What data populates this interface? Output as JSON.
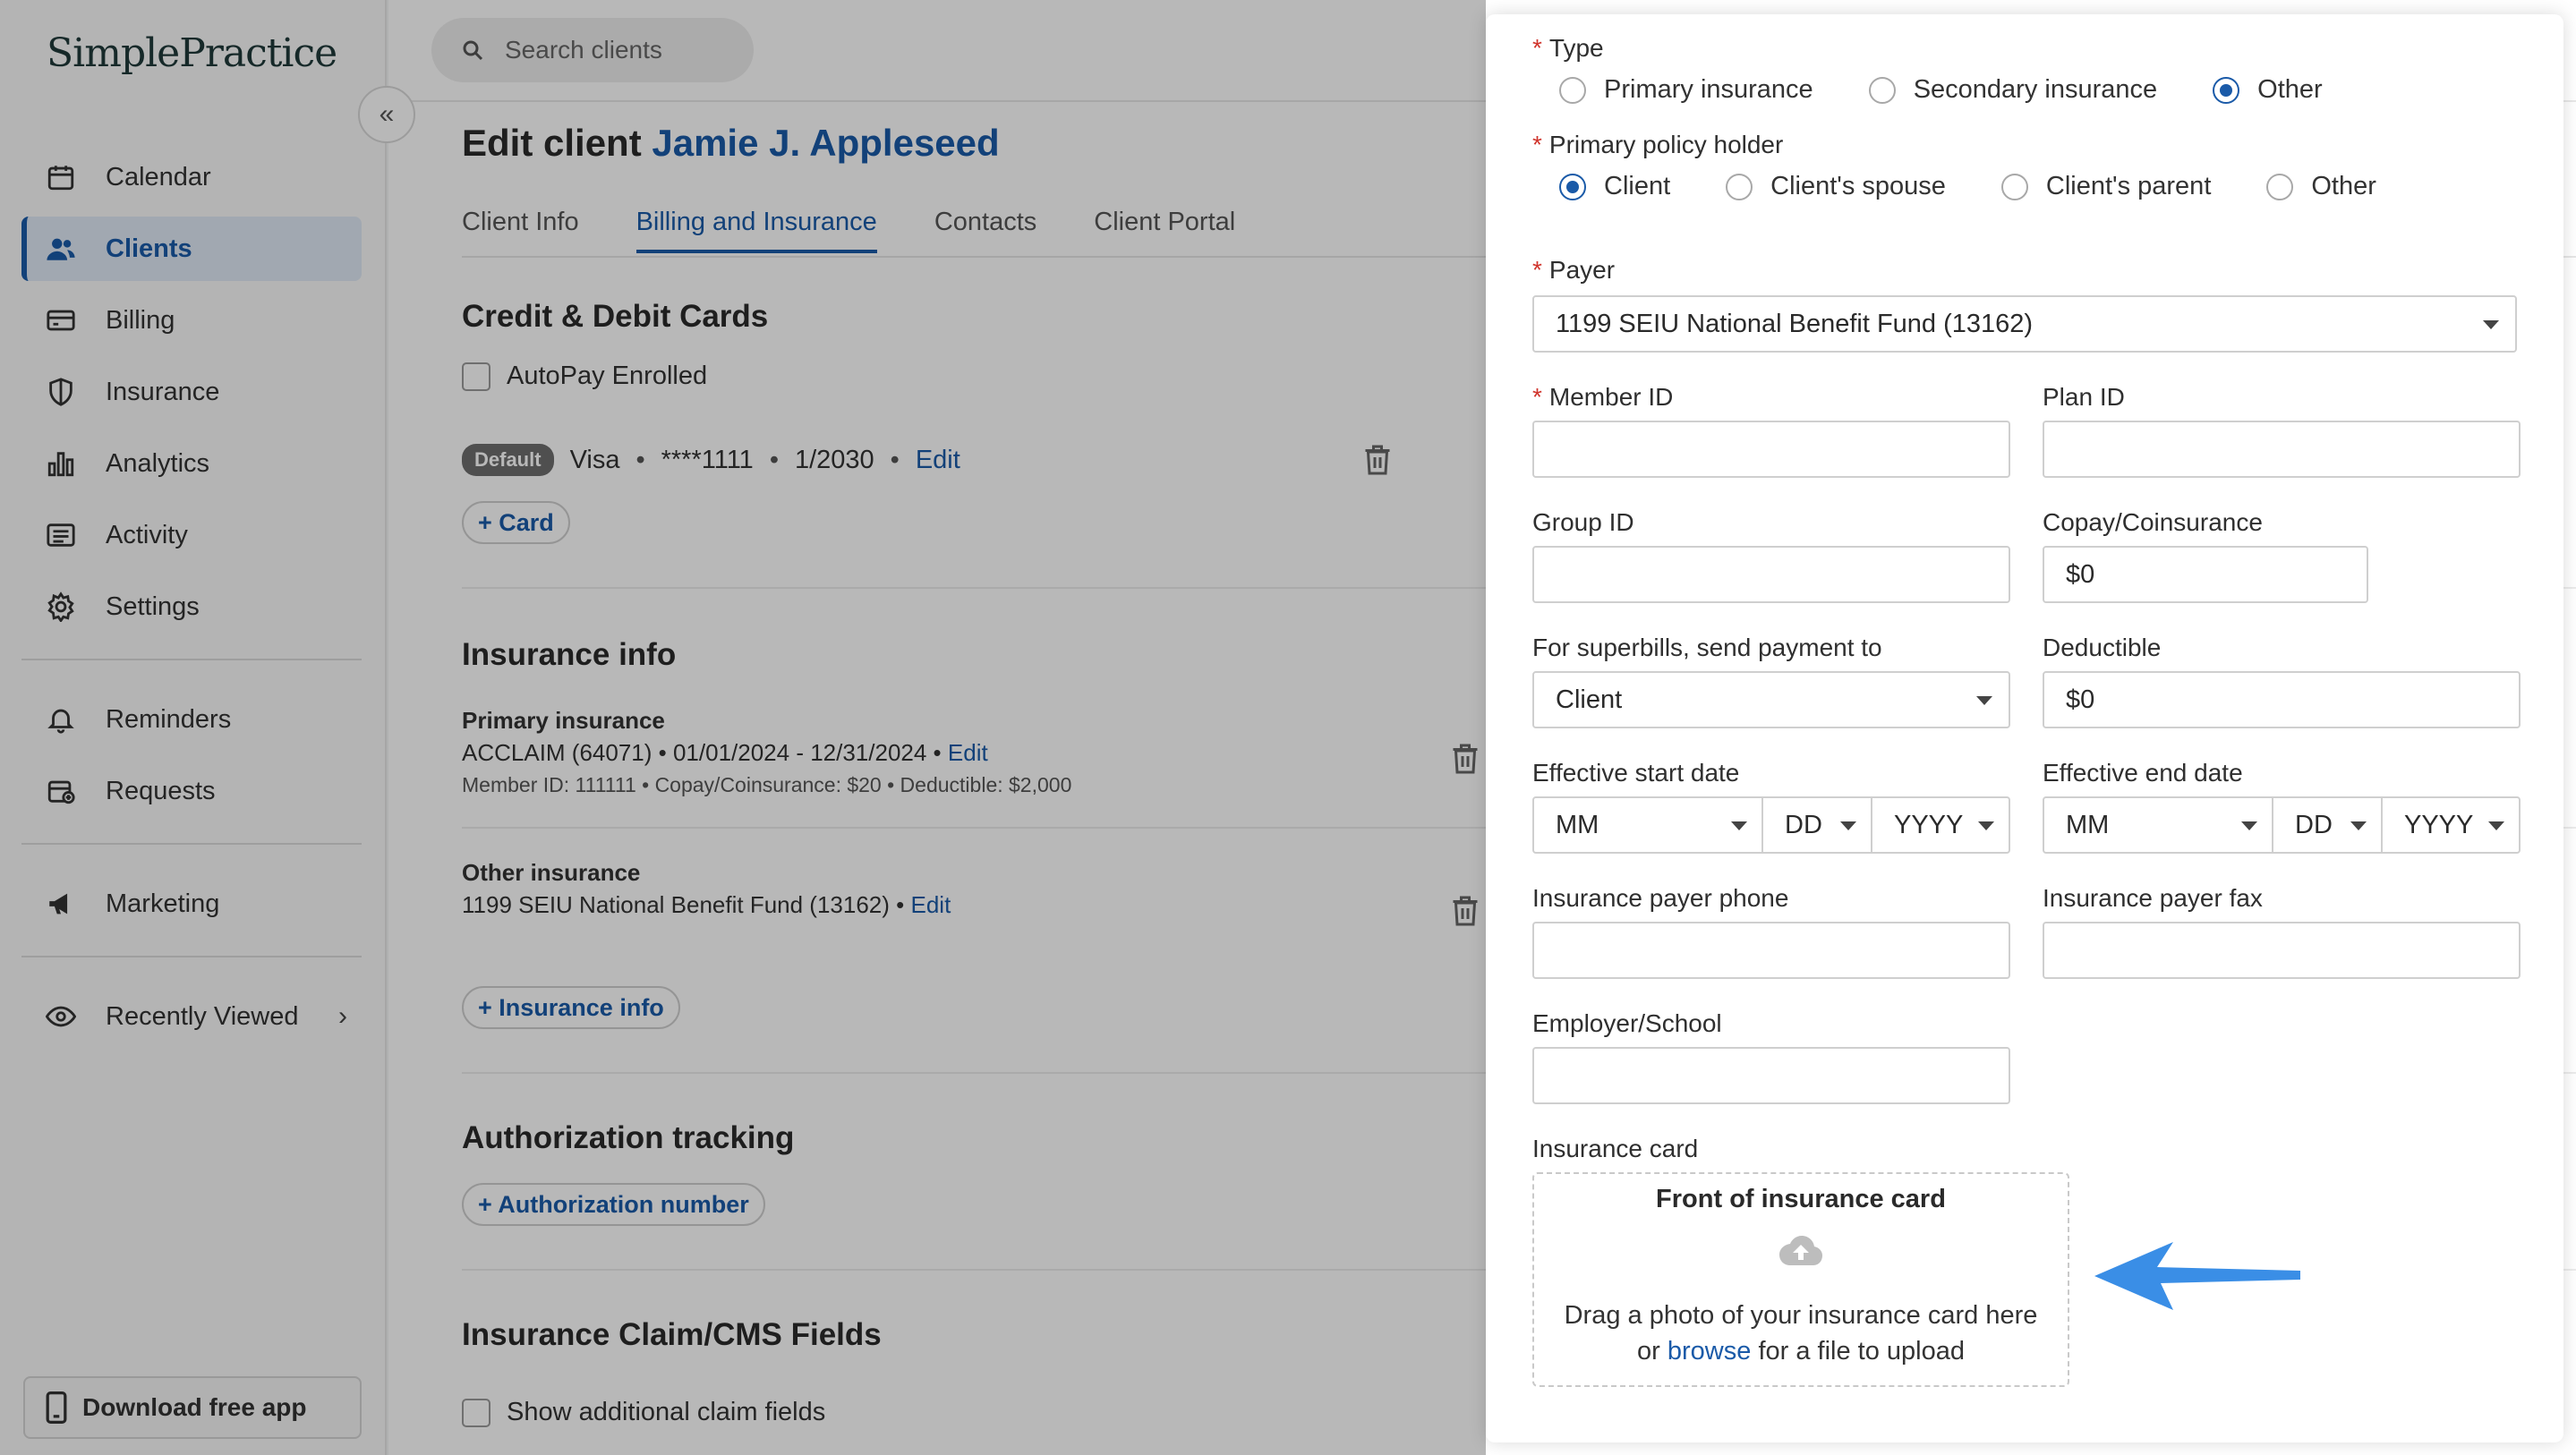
{
  "sidebar": {
    "logo": "SimplePractice",
    "collapse_icon": "«",
    "nav": [
      {
        "label": "Calendar",
        "icon": "calendar-icon"
      },
      {
        "label": "Clients",
        "icon": "clients-icon"
      },
      {
        "label": "Billing",
        "icon": "billing-icon"
      },
      {
        "label": "Insurance",
        "icon": "shield-icon"
      },
      {
        "label": "Analytics",
        "icon": "analytics-icon"
      },
      {
        "label": "Activity",
        "icon": "activity-icon"
      },
      {
        "label": "Settings",
        "icon": "gear-icon"
      },
      {
        "label": "Reminders",
        "icon": "bell-icon"
      },
      {
        "label": "Requests",
        "icon": "requests-icon"
      },
      {
        "label": "Marketing",
        "icon": "megaphone-icon"
      },
      {
        "label": "Recently Viewed",
        "icon": "eye-icon",
        "chevron": "›"
      }
    ],
    "download_label": "Download free app"
  },
  "topbar": {
    "search_placeholder": "Search clients"
  },
  "page": {
    "title_prefix": "Edit client",
    "client_name": "Jamie J. Appleseed",
    "tabs": [
      "Client Info",
      "Billing and Insurance",
      "Contacts",
      "Client Portal"
    ]
  },
  "cards": {
    "title": "Credit & Debit Cards",
    "autopay_label": "AutoPay Enrolled",
    "default_badge": "Default",
    "card_brand": "Visa",
    "card_number": "****1111",
    "card_expiry": "1/2030",
    "bullet": "•",
    "edit_label": "Edit",
    "add_card_label": "+ Card"
  },
  "insurance_info": {
    "title": "Insurance info",
    "primary_label": "Primary insurance",
    "primary_line": "ACCLAIM (64071)  •  01/01/2024 - 12/31/2024  •",
    "primary_sub": "Member ID: 111111  •  Copay/Coinsurance: $20  •  Deductible: $2,000",
    "other_label": "Other insurance",
    "other_line": "1199 SEIU National Benefit Fund (13162)  •",
    "edit_label": "Edit",
    "add_label": "+ Insurance info"
  },
  "authorization": {
    "title": "Authorization tracking",
    "add_label": "+ Authorization number"
  },
  "claims": {
    "title": "Insurance Claim/CMS Fields",
    "show_label": "Show additional claim fields"
  },
  "drawer": {
    "required_mark": "*",
    "type_label": "Type",
    "type_options": [
      "Primary insurance",
      "Secondary insurance",
      "Other"
    ],
    "type_selected": "Other",
    "holder_label": "Primary policy holder",
    "holder_options": [
      "Client",
      "Client's spouse",
      "Client's parent",
      "Other"
    ],
    "holder_selected": "Client",
    "payer_label": "Payer",
    "payer_value": "1199 SEIU National Benefit Fund (13162)",
    "member_id_label": "Member ID",
    "member_id_value": "",
    "plan_id_label": "Plan ID",
    "plan_id_value": "",
    "group_id_label": "Group ID",
    "group_id_value": "",
    "copay_label": "Copay/Coinsurance",
    "copay_value": "$0",
    "superbill_label": "For superbills, send payment to",
    "superbill_value": "Client",
    "deductible_label": "Deductible",
    "deductible_value": "$0",
    "start_label": "Effective start date",
    "end_label": "Effective end date",
    "date_mm": "MM",
    "date_dd": "DD",
    "date_yyyy": "YYYY",
    "payer_phone_label": "Insurance payer phone",
    "payer_fax_label": "Insurance payer fax",
    "employer_label": "Employer/School",
    "card_label": "Insurance card",
    "upload_title": "Front of insurance card",
    "upload_line1": "Drag a photo of your insurance card here",
    "upload_or": "or",
    "upload_browse": "browse",
    "upload_line2_rest": "for a file to upload"
  },
  "colors": {
    "accent": "#1a5aa8",
    "required": "#d0342c",
    "arrow": "#3a8ee6"
  }
}
